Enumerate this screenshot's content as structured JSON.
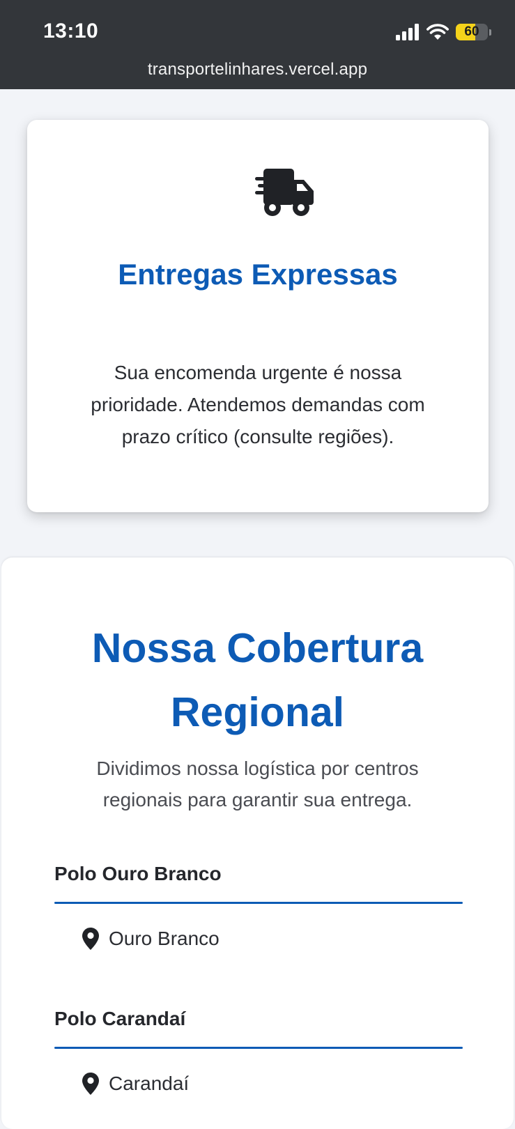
{
  "status_bar": {
    "time": "13:10",
    "battery_level": "60",
    "battery_fraction": 0.6,
    "signal_icon": "signal-bars-icon",
    "wifi_icon": "wifi-icon"
  },
  "browser": {
    "url": "transportelinhares.vercel.app"
  },
  "service_card": {
    "icon": "truck-fast-icon",
    "title": "Entregas Expressas",
    "description": "Sua encomenda urgente é nossa prioridade. Atendemos demandas com prazo crítico (consulte regiões)."
  },
  "coverage": {
    "title": "Nossa Cobertura Regional",
    "subtitle": "Dividimos nossa logística por centros regionais para garantir sua entrega.",
    "polos": [
      {
        "name": "Polo Ouro Branco",
        "cities": [
          "Ouro Branco"
        ]
      },
      {
        "name": "Polo Carandaí",
        "cities": [
          "Carandaí"
        ]
      }
    ]
  },
  "colors": {
    "accent": "#0d5bb5",
    "topbar": "#33363a",
    "page_bg": "#f2f4f8",
    "battery": "#f5d31a"
  }
}
